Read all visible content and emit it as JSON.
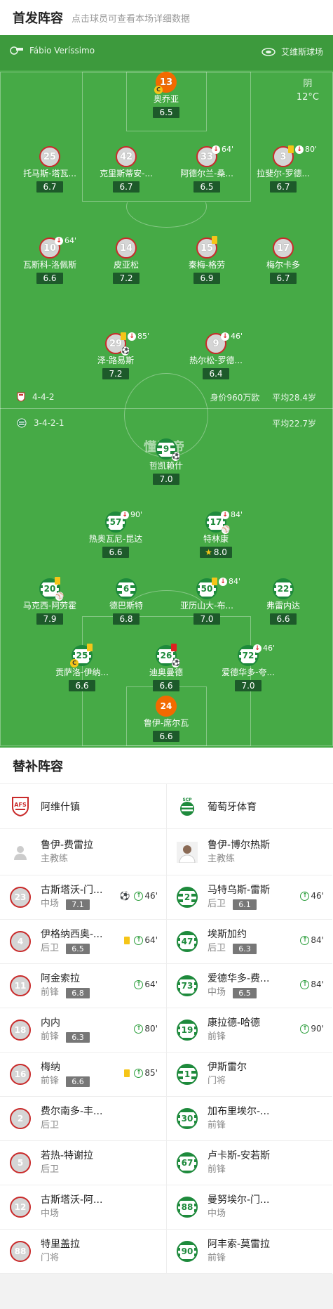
{
  "header": {
    "title": "首发阵容",
    "subtitle": "点击球员可查看本场详细数据"
  },
  "pitch": {
    "referee": "Fábio Veríssimo",
    "stadium": "艾维斯球场",
    "weather": "阴",
    "temperature": "12°C",
    "away_formation": "4-4-2",
    "away_value": "身价960万欧",
    "away_age": "平均28.4岁",
    "home_formation": "3-4-2-1",
    "home_age": "平均22.7岁",
    "watermark": "懂球帝"
  },
  "away_players": [
    {
      "num": "13",
      "name": "奥乔亚",
      "rating": "6.5"
    },
    {
      "num": "25",
      "name": "托马斯-塔瓦...",
      "rating": "6.7"
    },
    {
      "num": "42",
      "name": "克里斯蒂安-...",
      "rating": "6.7"
    },
    {
      "num": "33",
      "name": "阿德尔兰-桑...",
      "rating": "6.5",
      "sub": "64'"
    },
    {
      "num": "3",
      "name": "拉斐尔-罗德...",
      "rating": "6.7",
      "sub": "80'"
    },
    {
      "num": "10",
      "name": "瓦斯科-洛佩斯",
      "rating": "6.6",
      "sub": "64'"
    },
    {
      "num": "14",
      "name": "皮亚松",
      "rating": "7.2"
    },
    {
      "num": "15",
      "name": "秦梅-格劳",
      "rating": "6.9"
    },
    {
      "num": "17",
      "name": "梅尔卡多",
      "rating": "6.7"
    },
    {
      "num": "29",
      "name": "泽-路易斯",
      "rating": "7.2",
      "sub": "85'"
    },
    {
      "num": "9",
      "name": "热尔松-罗德...",
      "rating": "6.4",
      "sub": "46'"
    }
  ],
  "home_players": [
    {
      "num": "9",
      "name": "哲凯赖什",
      "rating": "7.0"
    },
    {
      "num": "57",
      "name": "热奥瓦尼-昆达",
      "rating": "6.6",
      "sub": "90'"
    },
    {
      "num": "17",
      "name": "特林康",
      "rating": "8.0",
      "sub": "84'"
    },
    {
      "num": "20",
      "name": "马克西-阿劳霍",
      "rating": "7.9"
    },
    {
      "num": "6",
      "name": "德巴斯特",
      "rating": "6.8"
    },
    {
      "num": "50",
      "name": "亚历山大-布...",
      "rating": "7.0",
      "sub": "84'"
    },
    {
      "num": "22",
      "name": "弗雷内达",
      "rating": "6.6"
    },
    {
      "num": "25",
      "name": "贡萨洛-伊纳...",
      "rating": "6.6"
    },
    {
      "num": "26",
      "name": "迪奥曼德",
      "rating": "6.6"
    },
    {
      "num": "72",
      "name": "爱德华多-夸...",
      "rating": "7.0",
      "sub": "46'"
    },
    {
      "num": "24",
      "name": "鲁伊-席尔瓦",
      "rating": "6.6"
    }
  ],
  "subs": {
    "title": "替补阵容",
    "left": {
      "team": "阿维什镇",
      "coach_name": "鲁伊-费雷拉",
      "coach_role": "主教练",
      "players": [
        {
          "num": "23",
          "name": "古斯塔沃-门...",
          "pos": "中场",
          "rating": "7.1",
          "on": "46'"
        },
        {
          "num": "4",
          "name": "伊格纳西奥-...",
          "pos": "后卫",
          "rating": "6.5",
          "on": "64'"
        },
        {
          "num": "11",
          "name": "阿金索拉",
          "pos": "前锋",
          "rating": "6.8",
          "on": "64'"
        },
        {
          "num": "18",
          "name": "内内",
          "pos": "前锋",
          "rating": "6.3",
          "on": "80'"
        },
        {
          "num": "16",
          "name": "梅纳",
          "pos": "前锋",
          "rating": "6.6",
          "on": "85'"
        },
        {
          "num": "2",
          "name": "费尔南多-丰...",
          "pos": "后卫"
        },
        {
          "num": "5",
          "name": "若热-特谢拉",
          "pos": "后卫"
        },
        {
          "num": "12",
          "name": "古斯塔沃-阿...",
          "pos": "中场"
        },
        {
          "num": "88",
          "name": "特里盖拉",
          "pos": "门将"
        }
      ]
    },
    "right": {
      "team": "葡萄牙体育",
      "coach_name": "鲁伊-博尔热斯",
      "coach_role": "主教练",
      "players": [
        {
          "num": "2",
          "name": "马特乌斯-雷斯",
          "pos": "后卫",
          "rating": "6.1",
          "on": "46'"
        },
        {
          "num": "47",
          "name": "埃斯加约",
          "pos": "后卫",
          "rating": "6.3",
          "on": "84'"
        },
        {
          "num": "73",
          "name": "爱德华多-费...",
          "pos": "中场",
          "rating": "6.5",
          "on": "84'"
        },
        {
          "num": "19",
          "name": "康拉德-哈德",
          "pos": "前锋",
          "on": "90'"
        },
        {
          "num": "1",
          "name": "伊斯雷尔",
          "pos": "门将"
        },
        {
          "num": "30",
          "name": "加布里埃尔-...",
          "pos": "前锋"
        },
        {
          "num": "67",
          "name": "卢卡斯-安若斯",
          "pos": "前锋"
        },
        {
          "num": "88",
          "name": "曼努埃尔-门...",
          "pos": "中场"
        },
        {
          "num": "90",
          "name": "阿丰索-莫雷拉",
          "pos": "前锋"
        }
      ]
    }
  }
}
